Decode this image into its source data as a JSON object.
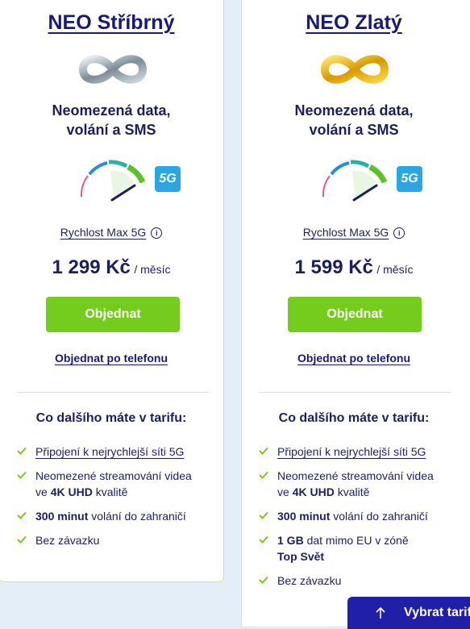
{
  "plans": [
    {
      "title": "NEO Stříbrný",
      "logo_icon": "silver-infinity-icon",
      "headline_1": "Neomezená data,",
      "headline_2": "volání a SMS",
      "badge": "5G",
      "speed_label": "Rychlost Max 5G",
      "price": "1 299 Kč",
      "price_unit": "/ měsíc",
      "order_label": "Objednat",
      "phone_order_label": "Objednat po telefonu",
      "extras_title": "Co dalšího máte v tarifu:",
      "features": {
        "f1": "Připojení k nejrychlejší síti 5G",
        "f2_a": "Neomezené streamování videa",
        "f2_b": "ve",
        "f2_bold": "4K UHD",
        "f2_c": "kvalitě",
        "f3_bold": "300 minut",
        "f3_rest": "volání do zahraničí",
        "f4": "Bez závazku"
      }
    },
    {
      "title": "NEO Zlatý",
      "logo_icon": "gold-infinity-icon",
      "headline_1": "Neomezená data,",
      "headline_2": "volání a SMS",
      "badge": "5G",
      "speed_label": "Rychlost Max 5G",
      "price": "1 599 Kč",
      "price_unit": "/ měsíc",
      "order_label": "Objednat",
      "phone_order_label": "Objednat po telefonu",
      "extras_title": "Co dalšího máte v tarifu:",
      "features": {
        "f1": "Připojení k nejrychlejší síti 5G",
        "f2_a": "Neomezené streamování videa",
        "f2_b": "ve",
        "f2_bold": "4K UHD",
        "f2_c": "kvalitě",
        "f3_bold": "300 minut",
        "f3_rest": "volání do zahraničí",
        "f4_bold": "1 GB",
        "f4_rest": "dat mimo EU v zóně",
        "f4_bold2": "Top Svět",
        "f5": "Bez závazku"
      }
    }
  ],
  "floating_button": {
    "label": "Vybrat tarif",
    "icon": "arrow-up-icon"
  },
  "colors": {
    "primary_text": "#1b1f5e",
    "order_green": "#74cc1c",
    "badge_blue": "#2aa6e4",
    "float_button": "#1f1fa8",
    "page_bg": "#e3eef8"
  }
}
